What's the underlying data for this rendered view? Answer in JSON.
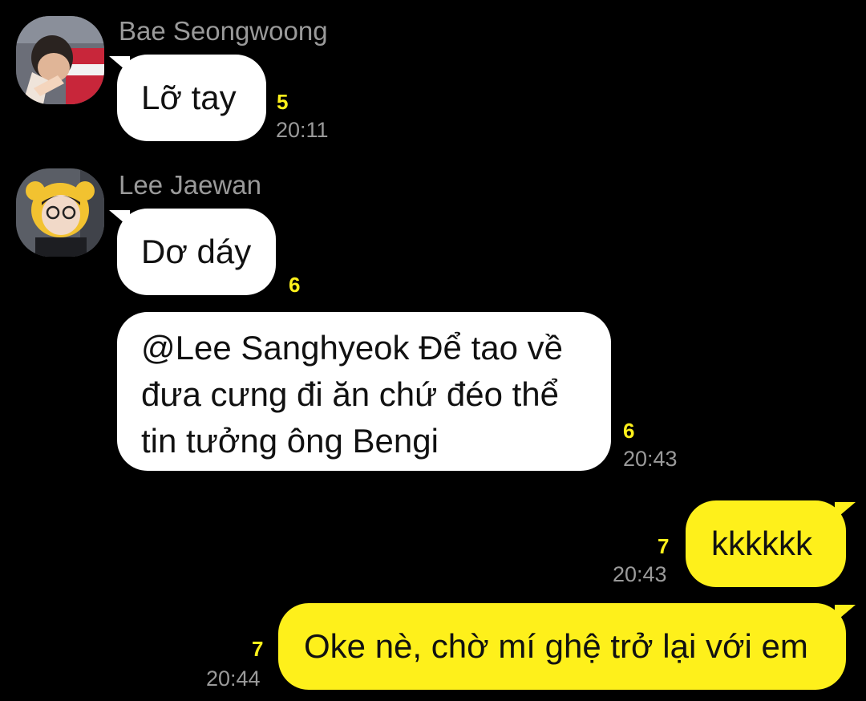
{
  "colors": {
    "background": "#000000",
    "incoming_bubble": "#ffffff",
    "outgoing_bubble": "#fef01b",
    "unread_count": "#fef01b",
    "meta_text": "#9a9a9a"
  },
  "messages": [
    {
      "sender": "Bae Seongwoong",
      "avatar": "profile-photo-avatar",
      "text": "Lỡ tay",
      "unread": "5",
      "time": "20:11"
    },
    {
      "sender": "Lee Jaewan",
      "avatar": "profile-photo-avatar",
      "text": "Dơ dáy",
      "unread": "6"
    },
    {
      "lines": [
        "@Lee Sanghyeok Để tao về",
        "đưa cưng đi ăn chứ đéo thể",
        "tin tưởng ông Bengi"
      ],
      "unread": "6",
      "time": "20:43"
    },
    {
      "text": "kkkkkk",
      "unread": "7",
      "time": "20:43",
      "outgoing": true
    },
    {
      "text": "Oke nè, chờ mí ghệ trở lại với em",
      "unread": "7",
      "time": "20:44",
      "outgoing": true
    }
  ]
}
